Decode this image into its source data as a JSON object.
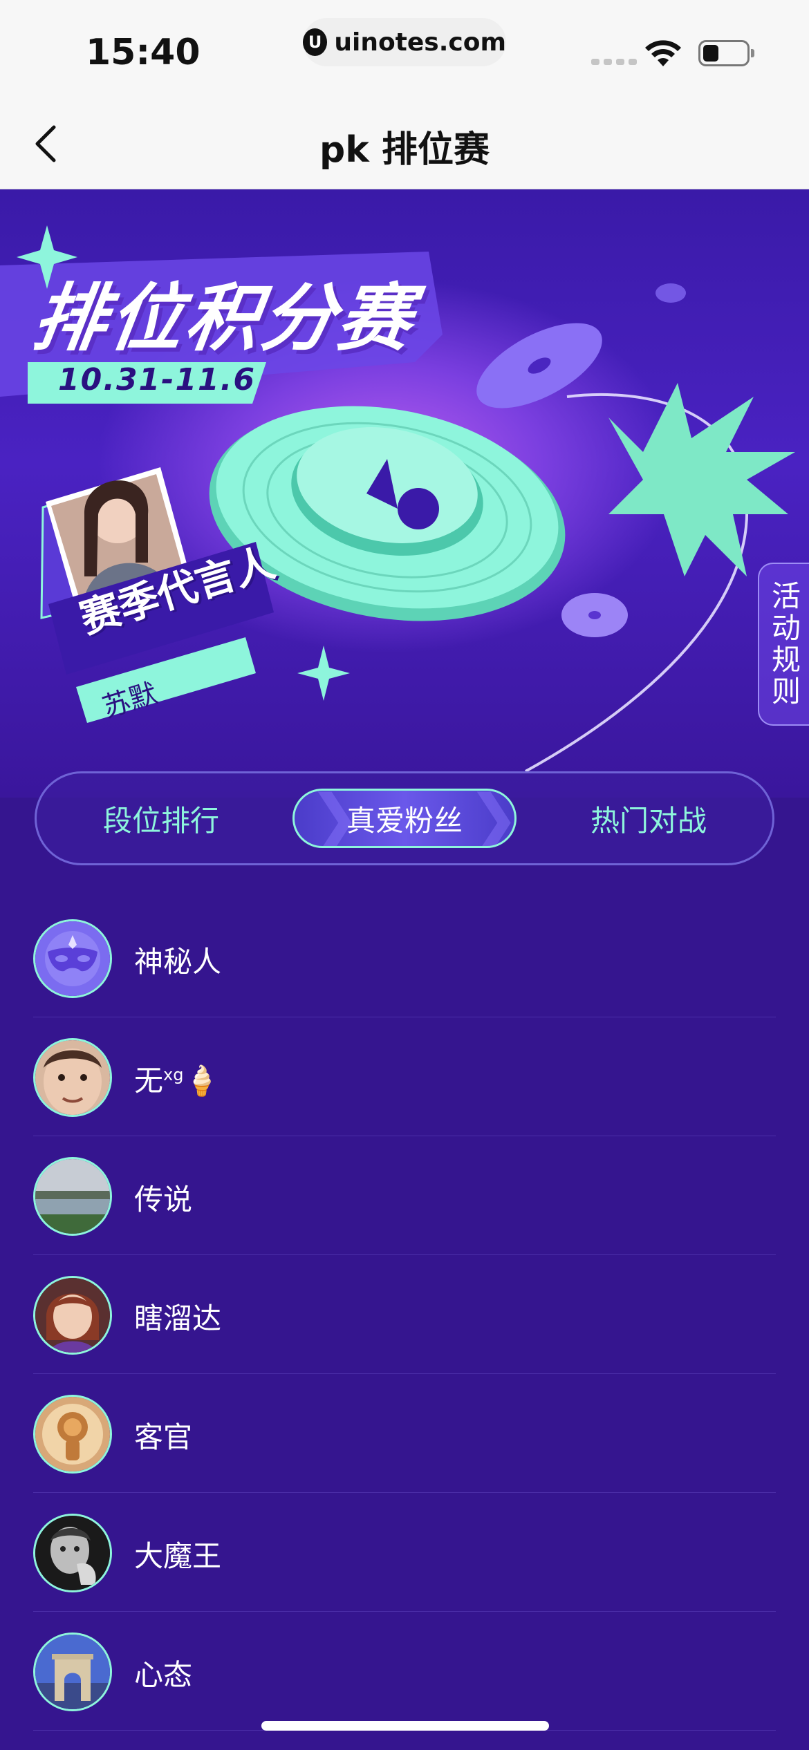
{
  "status_bar": {
    "time": "15:40",
    "url": "uinotes.com",
    "url_logo": "U",
    "icons": [
      "signal-icon",
      "wifi-icon",
      "battery-icon"
    ]
  },
  "nav": {
    "title": "pk 排位赛",
    "back_icon": "chevron-left-icon"
  },
  "banner": {
    "title": "排位积分赛",
    "date_range": "10.31-11.6",
    "ambassador_label": "赛季代言人",
    "ambassador_name": "苏默",
    "rules_button": "活动规则"
  },
  "tabs": [
    {
      "label": "段位排行",
      "active": false
    },
    {
      "label": "真爱粉丝",
      "active": true
    },
    {
      "label": "热门对战",
      "active": false
    }
  ],
  "fans": [
    {
      "name": "神秘人",
      "avatar": "mystery-mask-avatar"
    },
    {
      "name": "无",
      "name_sup": "xg",
      "name_emoji": "🍦",
      "avatar": "child-photo-avatar"
    },
    {
      "name": "传说",
      "avatar": "lake-landscape-avatar"
    },
    {
      "name": "瞎溜达",
      "avatar": "girl-portrait-avatar"
    },
    {
      "name": "客官",
      "avatar": "lion-figure-avatar"
    },
    {
      "name": "大魔王",
      "avatar": "bw-portrait-avatar"
    },
    {
      "name": "心态",
      "avatar": "arc-de-triomphe-avatar"
    }
  ],
  "colors": {
    "background": "#35158f",
    "accent": "#8ef5dc",
    "tab_border": "#6f63d6"
  }
}
